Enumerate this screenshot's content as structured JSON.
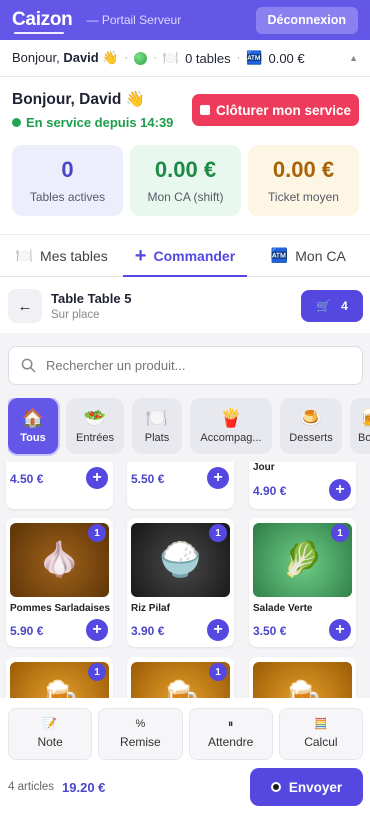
{
  "topbar": {
    "brand": "Caizon",
    "portal": "— Portail Serveur",
    "logout_label": "Déconnexion"
  },
  "statusbar": {
    "greeting_prefix": "Bonjour,",
    "name": "David",
    "wave": "👋",
    "tables": "0 tables",
    "ca": "0.00 €",
    "sep": "·"
  },
  "greeting": {
    "title": "Bonjour, David 👋",
    "service": "En service depuis 14:39",
    "close_label": "Clôturer mon service"
  },
  "kpis": [
    {
      "value": "0",
      "label": "Tables actives"
    },
    {
      "value": "0.00 €",
      "label": "Mon CA (shift)"
    },
    {
      "value": "0.00 €",
      "label": "Ticket moyen"
    }
  ],
  "tabs": [
    {
      "label": "Mes tables",
      "icon": "🍽️"
    },
    {
      "label": "Commander",
      "icon": "+"
    },
    {
      "label": "Mon CA",
      "icon": "🏧"
    }
  ],
  "order": {
    "table_name": "Table Table 5",
    "table_sub": "Sur place",
    "cart_count": "4"
  },
  "search": {
    "placeholder": "Rechercher un produit..."
  },
  "categories": [
    {
      "label": "Tous",
      "icon": "🏠"
    },
    {
      "label": "Entrées",
      "icon": "🥗"
    },
    {
      "label": "Plats",
      "icon": "🍽️"
    },
    {
      "label": "Accompag...",
      "icon": "🍟"
    },
    {
      "label": "Desserts",
      "icon": "🍮"
    },
    {
      "label": "Bo",
      "icon": "🍺"
    }
  ],
  "products_top": [
    {
      "name": "",
      "price": "4.50 €"
    },
    {
      "name": "",
      "price": "5.50 €"
    },
    {
      "name": "Jour",
      "price": "4.90 €"
    }
  ],
  "products_mid": [
    {
      "name": "Pommes Sarladaises",
      "price": "5.90 €",
      "badge": "1",
      "icon": "🧄"
    },
    {
      "name": "Riz Pilaf",
      "price": "3.90 €",
      "badge": "1",
      "icon": "🍚"
    },
    {
      "name": "Salade Verte",
      "price": "3.50 €",
      "badge": "1",
      "icon": "🥬"
    }
  ],
  "products_bottom": [
    {
      "badge": "1",
      "icon": "🍺"
    },
    {
      "badge": "1",
      "icon": "🍺"
    },
    {
      "badge": "",
      "icon": "🍺"
    }
  ],
  "actions": [
    {
      "label": "Note",
      "icon": "📝"
    },
    {
      "label": "Remise",
      "icon": "%"
    },
    {
      "label": "Attendre",
      "icon": "⏸"
    },
    {
      "label": "Calcul",
      "icon": "🧮"
    }
  ],
  "footer": {
    "count": "4 articles",
    "total": "19.20 €",
    "send_label": "Envoyer"
  }
}
